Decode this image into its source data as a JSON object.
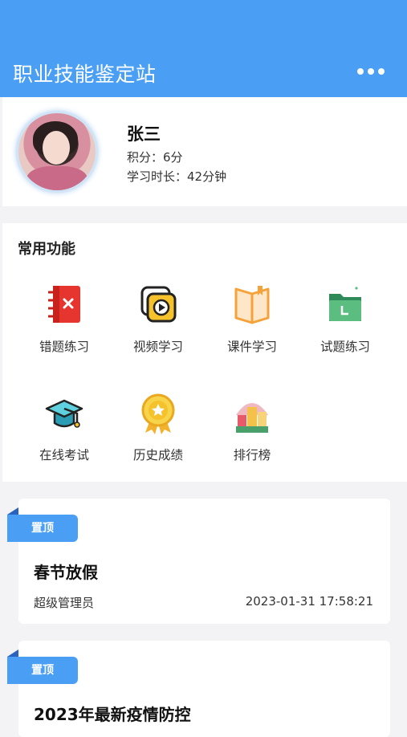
{
  "header": {
    "title": "职业技能鉴定站",
    "more_icon": "more-dots-icon"
  },
  "profile": {
    "name": "张三",
    "points": "积分：6分",
    "study_time": "学习时长：42分钟"
  },
  "functions": {
    "title": "常用功能",
    "items": [
      {
        "label": "错题练习",
        "icon": "notebook-x-icon"
      },
      {
        "label": "视频学习",
        "icon": "video-play-icon"
      },
      {
        "label": "课件学习",
        "icon": "open-book-icon"
      },
      {
        "label": "试题练习",
        "icon": "folder-icon"
      },
      {
        "label": "在线考试",
        "icon": "graduation-cap-icon"
      },
      {
        "label": "历史成绩",
        "icon": "medal-icon"
      },
      {
        "label": "排行榜",
        "icon": "podium-icon"
      }
    ]
  },
  "notices": [
    {
      "badge": "置顶",
      "title": "春节放假",
      "author": "超级管理员",
      "date": "2023-01-31 17:58:21"
    },
    {
      "badge": "置顶",
      "title": "2023年最新疫情防控"
    }
  ],
  "colors": {
    "header": "#4a9ff5",
    "accent": "#4a9ff5",
    "background": "#f3f3f5"
  }
}
